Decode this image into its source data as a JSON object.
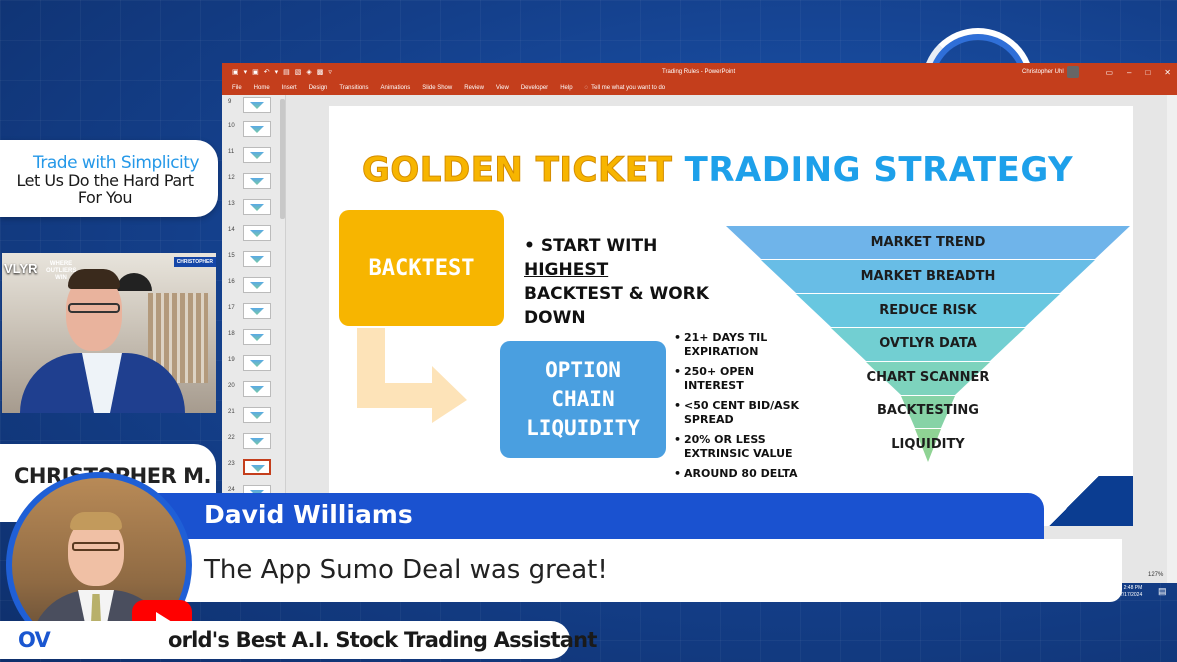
{
  "ppt": {
    "doc_title": "Trading Rules - PowerPoint",
    "user": "Christopher Uhl",
    "menu": [
      "File",
      "Home",
      "Insert",
      "Design",
      "Transitions",
      "Animations",
      "Slide Show",
      "Review",
      "View",
      "Developer",
      "Help"
    ],
    "tell_me": "Tell me what you want to do",
    "thumbnails": [
      "9",
      "10",
      "11",
      "12",
      "13",
      "14",
      "15",
      "16",
      "17",
      "18",
      "19",
      "20",
      "21",
      "22",
      "23",
      "24"
    ],
    "selected_slide": "23",
    "zoom": "127%"
  },
  "slide": {
    "title_part1": "GOLDEN TICKET",
    "title_part2": "TRADING STRATEGY",
    "backtest_label": "BACKTEST",
    "main_bullet_pre": "START WITH ",
    "main_bullet_underlined": "HIGHEST",
    "main_bullet_post": "BACKTEST & WORK DOWN",
    "option_box": [
      "OPTION",
      "CHAIN",
      "LIQUIDITY"
    ],
    "small_bullets": [
      "21+ DAYS TIL EXPIRATION",
      "250+ OPEN INTEREST",
      "<50 CENT BID/ASK SPREAD",
      "20% OR LESS EXTRINSIC VALUE",
      "AROUND 80 DELTA"
    ],
    "funnel": [
      "MARKET TREND",
      "MARKET BREADTH",
      "REDUCE RISK",
      "OVTLYR DATA",
      "CHART SCANNER",
      "BACKTESTING",
      "LIQUIDITY"
    ],
    "colors": {
      "gold": "#f7b500",
      "blue": "#1da0ea",
      "option_box": "#4a9fe0"
    }
  },
  "overlay": {
    "tagline_line1": "Trade with Simplicity",
    "tagline_line2": "Let Us Do the Hard Part For You",
    "webcam_logo": "VLYR",
    "webcam_badge": "CHRISTOPHER",
    "webcam_outliers": "WHERE OUTLIERS WIN",
    "host_name": "CHRISTOPHER M.",
    "comment_author": "David Williams",
    "comment_text": "The App Sumo Deal was great!",
    "ticker_brand": "OV",
    "ticker_text": "orld's Best A.I. Stock Trading Assistant",
    "clock_time": "2:48 PM",
    "clock_date": "7/17/2024"
  }
}
